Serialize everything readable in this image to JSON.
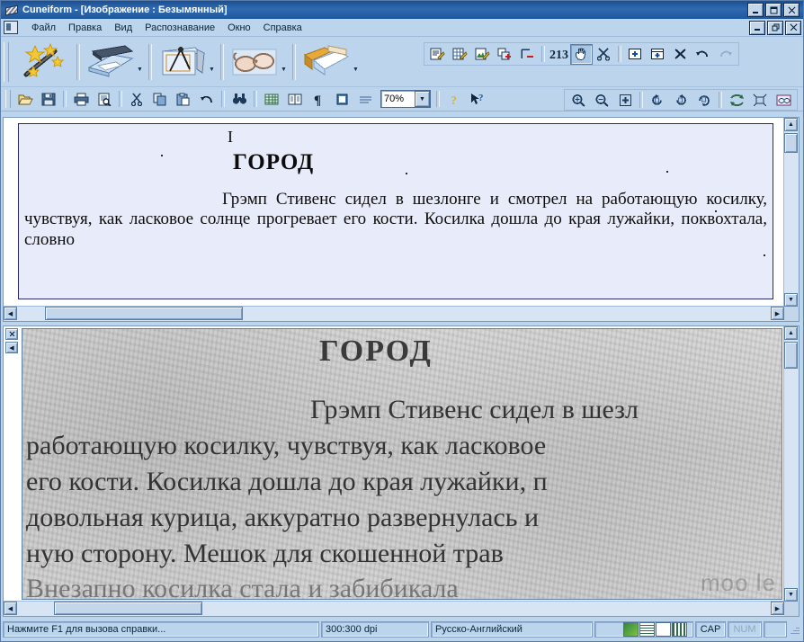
{
  "window": {
    "title": "Cuneiform - [Изображение : Безымянный]",
    "controls": {
      "minimize": "_",
      "maximize": "□",
      "close": "✕"
    },
    "mdi_controls": {
      "minimize": "_",
      "restore": "❐",
      "close": "✕"
    }
  },
  "menu": {
    "items": [
      {
        "label": "Файл",
        "name": "menu-file"
      },
      {
        "label": "Правка",
        "name": "menu-edit"
      },
      {
        "label": "Вид",
        "name": "menu-view"
      },
      {
        "label": "Распознавание",
        "name": "menu-recognition"
      },
      {
        "label": "Окно",
        "name": "menu-window"
      },
      {
        "label": "Справка",
        "name": "menu-help"
      }
    ]
  },
  "big_toolbar": {
    "buttons": [
      {
        "name": "magic-wand-button",
        "icon": "magic-wand-icon",
        "dropdown": false
      },
      {
        "name": "scan-button",
        "icon": "scanner-icon",
        "dropdown": true
      },
      {
        "name": "layout-button",
        "icon": "compass-layout-icon",
        "dropdown": true
      },
      {
        "name": "recognize-button",
        "icon": "glasses-icon",
        "dropdown": true
      },
      {
        "name": "export-button",
        "icon": "export-document-icon",
        "dropdown": true
      }
    ]
  },
  "block_toolbar": {
    "buttons": [
      {
        "name": "block-text-button",
        "icon": "block-text-icon"
      },
      {
        "name": "block-table-button",
        "icon": "block-table-icon"
      },
      {
        "name": "block-image-button",
        "icon": "block-image-icon"
      },
      {
        "name": "block-add-button",
        "icon": "block-add-icon"
      },
      {
        "name": "block-remove-button",
        "icon": "block-remove-icon"
      },
      {
        "name": "block-order-button",
        "icon": "numbering-213-icon",
        "label": "213"
      },
      {
        "name": "pan-button",
        "icon": "hand-icon",
        "pressed": true
      },
      {
        "name": "cut-block-button",
        "icon": "scissors-icon"
      },
      {
        "name": "frame-add-button",
        "icon": "frame-plus-icon"
      },
      {
        "name": "frame-insert-button",
        "icon": "frame-insert-icon"
      },
      {
        "name": "delete-button",
        "icon": "x-delete-icon"
      },
      {
        "name": "undo-block-button",
        "icon": "undo-arrow-icon"
      },
      {
        "name": "redo-block-button",
        "icon": "redo-arrow-icon"
      }
    ]
  },
  "standard_toolbar": {
    "buttons": [
      {
        "name": "open-button",
        "icon": "folder-open-icon"
      },
      {
        "name": "save-button",
        "icon": "floppy-save-icon"
      },
      {
        "name": "print-button",
        "icon": "printer-icon"
      },
      {
        "name": "print-preview-button",
        "icon": "print-preview-icon"
      },
      {
        "name": "cut-button",
        "icon": "scissors-icon"
      },
      {
        "name": "copy-button",
        "icon": "copy-icon"
      },
      {
        "name": "paste-button",
        "icon": "clipboard-paste-icon"
      },
      {
        "name": "undo-button",
        "icon": "undo-arrow-icon"
      },
      {
        "name": "find-button",
        "icon": "binoculars-icon"
      },
      {
        "name": "table-button",
        "icon": "table-grid-icon"
      },
      {
        "name": "columns-button",
        "icon": "columns-icon"
      },
      {
        "name": "paragraph-button",
        "icon": "pilcrow-icon"
      },
      {
        "name": "page-layout-button",
        "icon": "page-layout-icon"
      },
      {
        "name": "lines-button",
        "icon": "lines-icon"
      }
    ],
    "zoom": {
      "value": "70%",
      "name": "zoom-combo"
    },
    "help_buttons": [
      {
        "name": "help-button",
        "icon": "question-mark-icon"
      },
      {
        "name": "context-help-button",
        "icon": "arrow-question-icon"
      }
    ]
  },
  "image_toolbar": {
    "buttons": [
      {
        "name": "zoom-in-button",
        "icon": "magnifier-plus-icon"
      },
      {
        "name": "zoom-out-button",
        "icon": "magnifier-minus-icon"
      },
      {
        "name": "fit-page-button",
        "icon": "fit-page-icon"
      },
      {
        "name": "rotate-right-button",
        "icon": "rotate-cw-icon"
      },
      {
        "name": "rotate-left-button",
        "icon": "rotate-ccw-icon"
      },
      {
        "name": "rotate-180-button",
        "icon": "rotate-180-icon"
      },
      {
        "name": "invert-button",
        "icon": "invert-colors-icon"
      },
      {
        "name": "deskew-button",
        "icon": "deskew-icon"
      },
      {
        "name": "view-mode-button",
        "icon": "view-mode-icon"
      }
    ]
  },
  "text_pane": {
    "number_line": "I",
    "heading": "ГОРОД",
    "paragraph": "Грэмп Стивенс сидел в шезлонге и смотрел на работающую косилку, чувствуя, как ласковое солнце прогревает его кости. Косилка дошла до края лужайки, поквохтала, словно"
  },
  "image_pane": {
    "heading": "ГОРОД",
    "lines": [
      "Грэмп Стивенс сидел в шезл",
      "работающую косилку, чувствуя, как ласковое",
      "его кости. Косилка дошла до края лужайки, п",
      "довольная курица, аккуратно развернулась и",
      "ную сторону. Мешок для скошенной трав",
      "Внезапно косилка стала и забибикала"
    ],
    "watermark": "moo le"
  },
  "status_bar": {
    "hint": "Нажмите F1 для вызова справки...",
    "dpi": "300:300 dpi",
    "language": "Русско-Английский",
    "caps": "CAP",
    "num": "NUM"
  },
  "colors": {
    "title_start": "#1c4f8f",
    "toolbar_bg": "#bcd5ec",
    "page_bg": "#e8ecfa",
    "page_border": "#2a2a6e",
    "scan_bg": "#cfcfcf"
  }
}
